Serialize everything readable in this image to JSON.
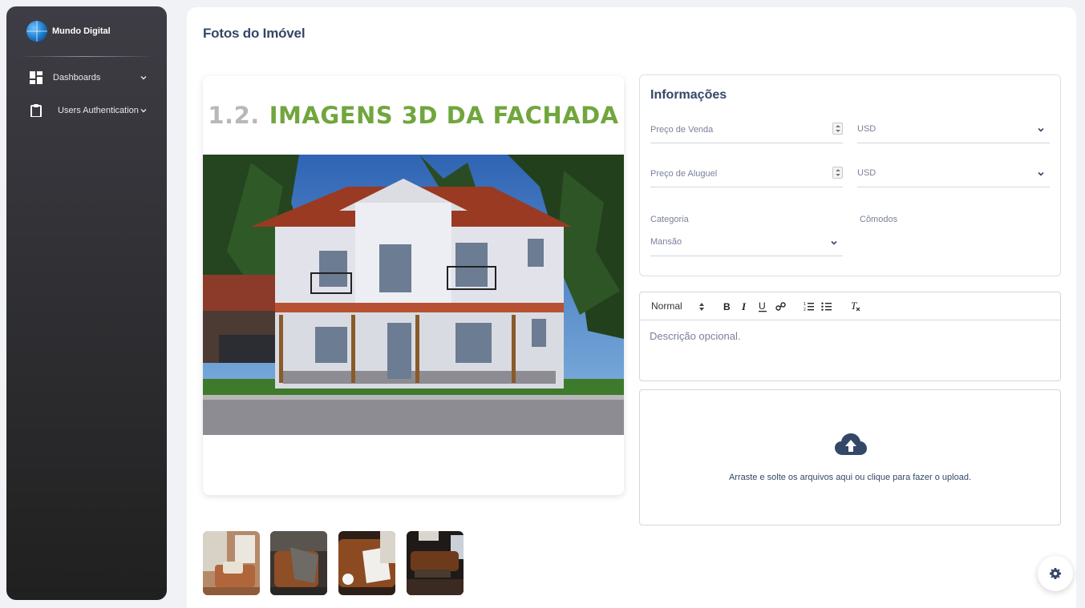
{
  "sidebar": {
    "brand": "Mundo Digital",
    "items": [
      {
        "label": "Dashboards",
        "icon": "dashboard-icon"
      },
      {
        "label": "Users Authentication",
        "icon": "clipboard-icon"
      }
    ]
  },
  "main": {
    "title": "Fotos do Imóvel",
    "feature": {
      "number": "1.2.",
      "heading": "IMAGENS 3D DA FACHADA"
    },
    "thumbnails": [
      {
        "alt": "sofa-thumbnail"
      },
      {
        "alt": "leather-chair-thumbnail"
      },
      {
        "alt": "leather-couch-thumbnail"
      },
      {
        "alt": "living-room-thumbnail"
      }
    ]
  },
  "info": {
    "title": "Informações",
    "sale_price_label": "Preço de Venda",
    "sale_currency": "USD",
    "rent_price_label": "Preço de Aluguel",
    "rent_currency": "USD",
    "category_label": "Categoria",
    "category_value": "Mansão",
    "rooms_label": "Cômodos"
  },
  "editor": {
    "format": "Normal",
    "placeholder": "Descrição opcional."
  },
  "upload": {
    "text": "Arraste e solte os arquivos aqui ou clique para fazer o upload."
  },
  "colors": {
    "accent": "#344767",
    "sidebar_top": "#3e3d45",
    "sidebar_bottom": "#202020",
    "heading_green": "#71a63e"
  }
}
